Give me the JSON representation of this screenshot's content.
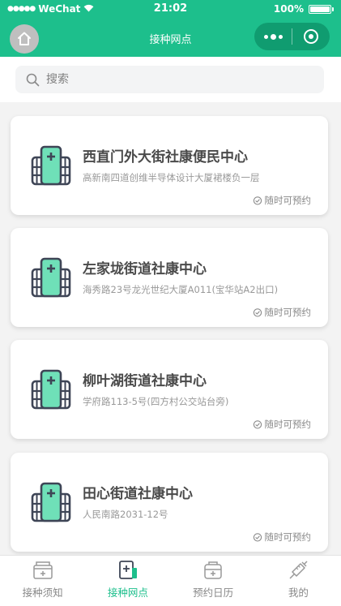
{
  "status_bar": {
    "carrier": "WeChat",
    "time": "21:02",
    "battery": "100%"
  },
  "nav": {
    "title": "接种网点"
  },
  "search": {
    "placeholder": "搜索"
  },
  "clinics": [
    {
      "name": "西直门外大街社康便民中心",
      "address": "高新南四道创维半导体设计大厦裙楼负一层",
      "status": "随时可预约"
    },
    {
      "name": "左家垅街道社康中心",
      "address": "海秀路23号龙光世纪大厦A011(宝华站A2出口)",
      "status": "随时可预约"
    },
    {
      "name": "柳叶湖街道社康中心",
      "address": "学府路113-5号(四方村公交站台旁)",
      "status": "随时可预约"
    },
    {
      "name": "田心街道社康中心",
      "address": "人民南路2031-12号",
      "status": "随时可预约"
    }
  ],
  "tabs": [
    {
      "label": "接种须知",
      "icon": "notice-icon",
      "active": false
    },
    {
      "label": "接种网点",
      "icon": "clinic-icon",
      "active": true
    },
    {
      "label": "预约日历",
      "icon": "calendar-kit-icon",
      "active": false
    },
    {
      "label": "我的",
      "icon": "syringe-icon",
      "active": false
    }
  ],
  "colors": {
    "brand": "#1dbf8c",
    "capsule": "#109c70",
    "building_fill": "#6fe0b8",
    "building_stroke": "#3e4556"
  }
}
